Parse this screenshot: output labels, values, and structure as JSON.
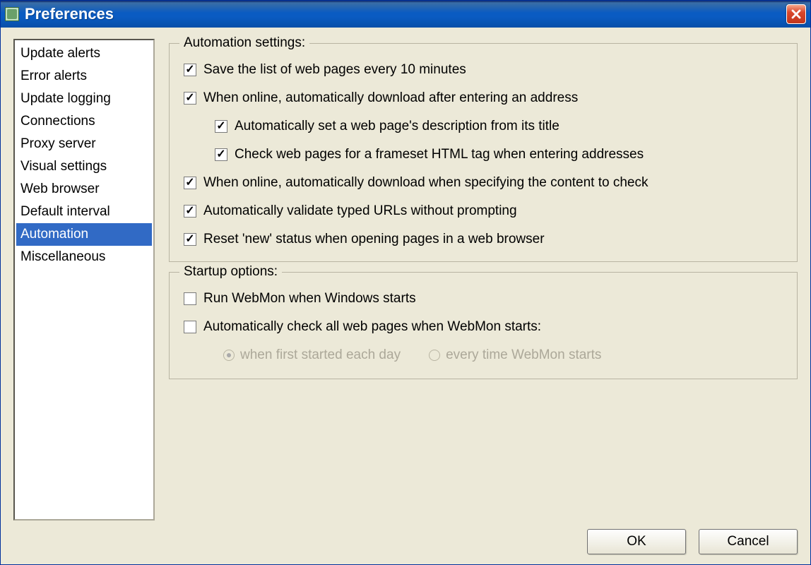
{
  "window": {
    "title": "Preferences"
  },
  "sidebar": {
    "items": [
      {
        "label": "Update alerts"
      },
      {
        "label": "Error alerts"
      },
      {
        "label": "Update logging"
      },
      {
        "label": "Connections"
      },
      {
        "label": "Proxy server"
      },
      {
        "label": "Visual settings"
      },
      {
        "label": "Web browser"
      },
      {
        "label": "Default interval"
      },
      {
        "label": "Automation",
        "selected": true
      },
      {
        "label": "Miscellaneous"
      }
    ]
  },
  "groups": {
    "automation": {
      "legend": "Automation settings:",
      "options": [
        {
          "label": "Save the list of web pages every 10 minutes",
          "checked": true
        },
        {
          "label": "When online, automatically download after entering an address",
          "checked": true
        },
        {
          "label": "Automatically set a web page's description from its title",
          "checked": true,
          "sub": true
        },
        {
          "label": "Check web pages for a frameset HTML tag when entering addresses",
          "checked": true,
          "sub": true
        },
        {
          "label": "When online, automatically download when specifying the content to check",
          "checked": true
        },
        {
          "label": "Automatically validate typed URLs without prompting",
          "checked": true
        },
        {
          "label": "Reset 'new' status when opening pages in a web browser",
          "checked": true
        }
      ]
    },
    "startup": {
      "legend": "Startup options:",
      "options": [
        {
          "label": "Run WebMon when Windows starts",
          "checked": false
        },
        {
          "label": "Automatically check all web pages when WebMon starts:",
          "checked": false
        }
      ],
      "radios": [
        {
          "label": "when first started each day",
          "selected": true
        },
        {
          "label": "every time WebMon starts",
          "selected": false
        }
      ]
    }
  },
  "buttons": {
    "ok": "OK",
    "cancel": "Cancel"
  }
}
